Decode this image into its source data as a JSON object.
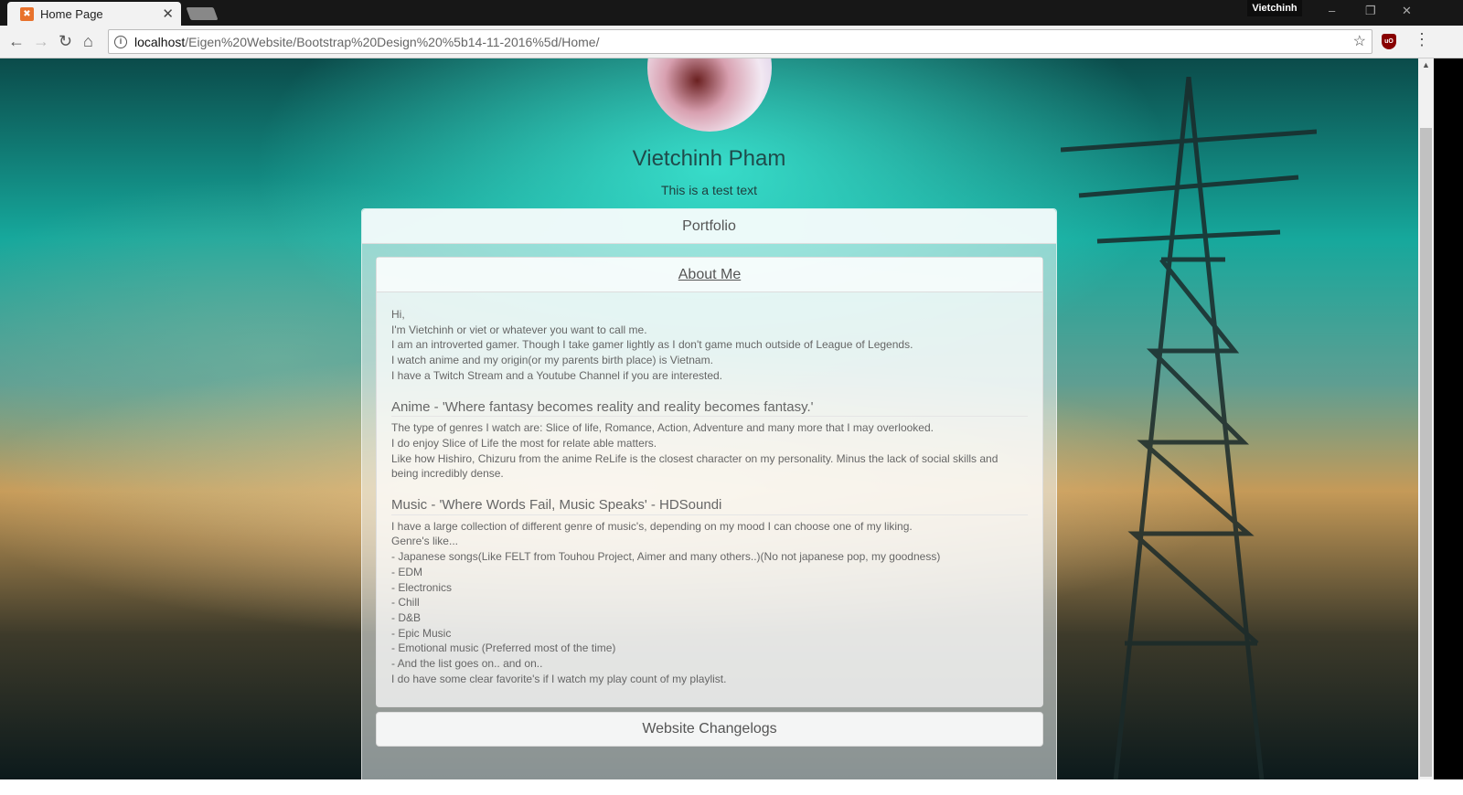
{
  "browser": {
    "tab_title": "Home Page",
    "profile": "Vietchinh",
    "url_host": "localhost",
    "url_path": "/Eigen%20Website/Bootstrap%20Design%20%5b14-11-2016%5d/Home/"
  },
  "profile": {
    "name": "Vietchinh Pham",
    "subtitle": "This is a test text"
  },
  "panel": {
    "title": "Portfolio"
  },
  "about": {
    "title": "About Me ",
    "intro": [
      "Hi,",
      "I'm Vietchinh or viet or whatever you want to call me.",
      "I am an introverted gamer. Though I take gamer lightly as I don't game much outside of League of Legends.",
      "I watch anime and my origin(or my parents birth place) is Vietnam.",
      "I have a Twitch Stream and a Youtube Channel if you are interested."
    ],
    "anime_heading": "Anime - 'Where fantasy becomes reality and reality becomes fantasy.'",
    "anime": [
      "The type of genres I watch are: Slice of life, Romance, Action, Adventure and many more that I may overlooked.",
      "I do enjoy Slice of Life the most for relate able matters.",
      "Like how Hishiro, Chizuru from the anime ReLife is the closest character on my personality. Minus the lack of social skills and being incredibly dense."
    ],
    "music_heading": "Music - 'Where Words Fail, Music Speaks' - HDSoundi",
    "music": [
      "I have a large collection of different genre of music's, depending on my mood I can choose one of my liking.",
      "Genre's like...",
      "- Japanese songs(Like FELT from Touhou Project, Aimer and many others..)(No not japanese pop, my goodness)",
      "- EDM",
      "- Electronics",
      "- Chill",
      "- D&B",
      "- Epic Music",
      "- Emotional music (Preferred most of the time)",
      "- And the list goes on.. and on..",
      "I do have some clear favorite's if I watch my play count of my playlist."
    ]
  },
  "changelog": {
    "title": "Website Changelogs"
  }
}
